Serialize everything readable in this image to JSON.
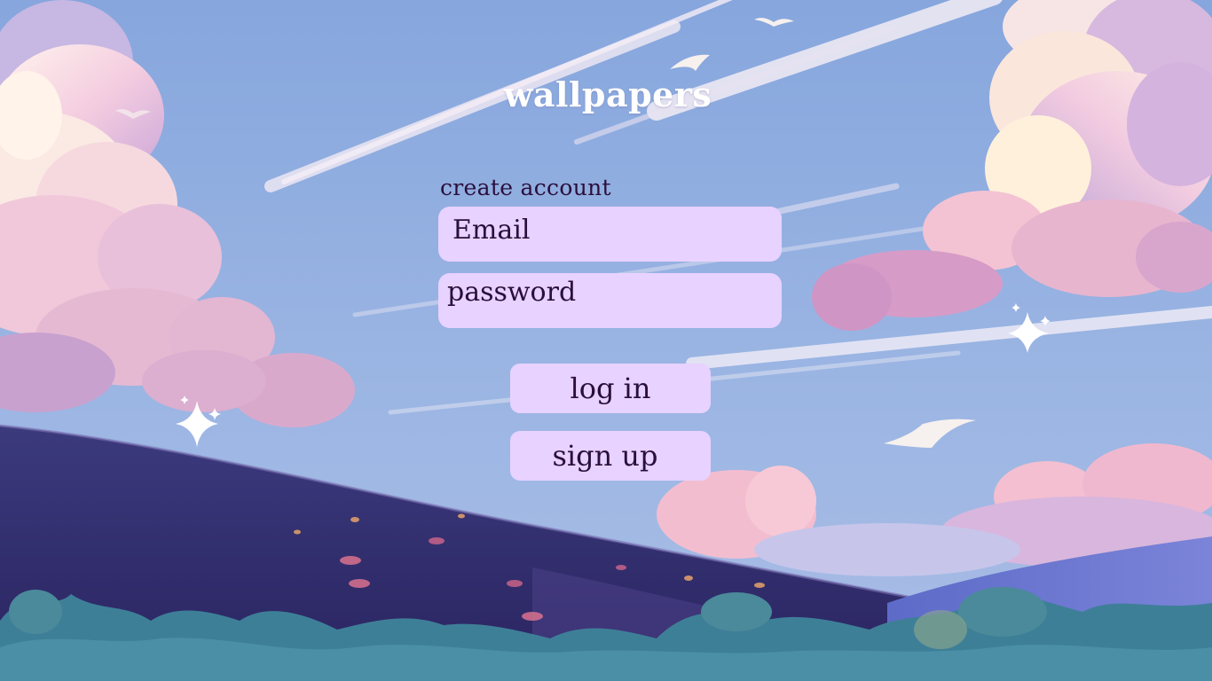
{
  "app": {
    "title": "wallpapers"
  },
  "form": {
    "heading": "create account",
    "email_placeholder": "Email",
    "password_placeholder": "password"
  },
  "buttons": {
    "login_label": "log in",
    "signup_label": "sign up"
  },
  "colors": {
    "sky": "#8fa9dc",
    "field_background": "#e8d2ff",
    "text_dark": "#2a0f3c",
    "title_text": "#ffffff",
    "hill_dark": "#3a3575",
    "foliage": "#3e7f98"
  }
}
